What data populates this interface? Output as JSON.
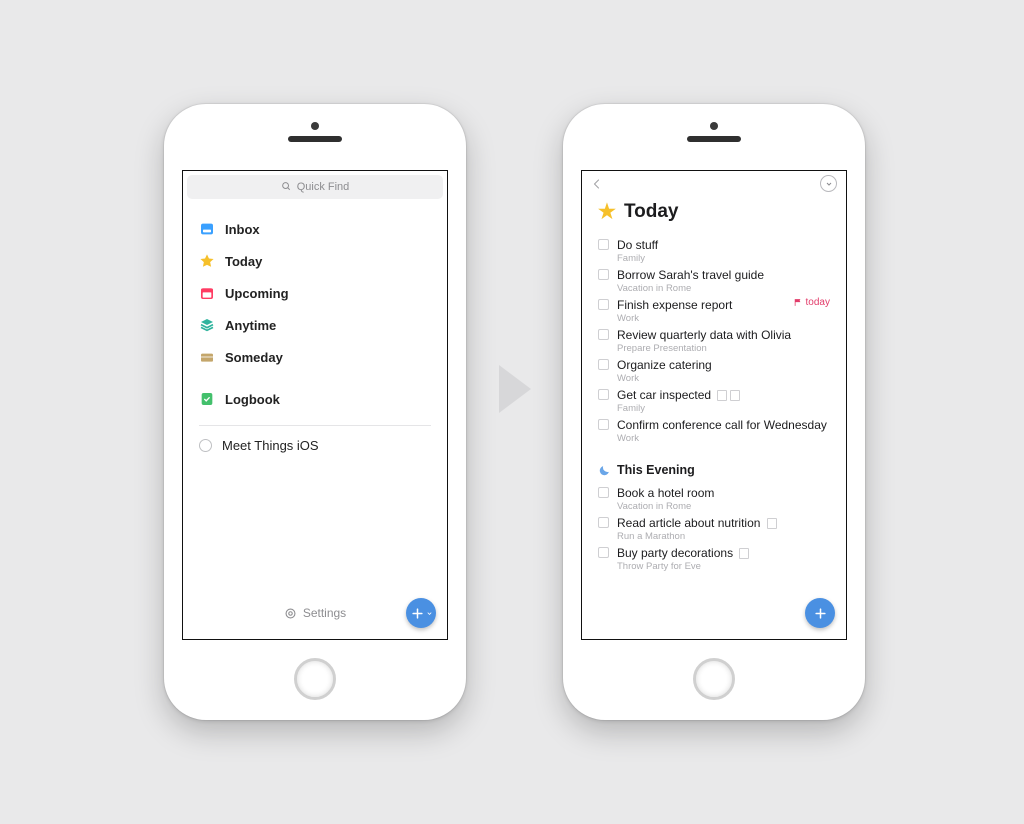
{
  "left": {
    "quickFindPlaceholder": "Quick Find",
    "nav": [
      {
        "label": "Inbox"
      },
      {
        "label": "Today"
      },
      {
        "label": "Upcoming"
      },
      {
        "label": "Anytime"
      },
      {
        "label": "Someday"
      },
      {
        "label": "Logbook"
      }
    ],
    "project": {
      "label": "Meet Things iOS"
    },
    "settingsLabel": "Settings"
  },
  "right": {
    "title": "Today",
    "tasks": [
      {
        "title": "Do stuff",
        "sub": "Family"
      },
      {
        "title": "Borrow Sarah's travel guide",
        "sub": "Vacation in Rome"
      },
      {
        "title": "Finish expense report",
        "sub": "Work",
        "flag": "today"
      },
      {
        "title": "Review quarterly data with Olivia",
        "sub": "Prepare Presentation"
      },
      {
        "title": "Organize catering",
        "sub": "Work"
      },
      {
        "title": "Get car inspected",
        "sub": "Family",
        "badges": true
      },
      {
        "title": "Confirm conference call for Wednesday",
        "sub": "Work"
      }
    ],
    "eveningTitle": "This Evening",
    "evening": [
      {
        "title": "Book a hotel room",
        "sub": "Vacation in Rome"
      },
      {
        "title": "Read article about nutrition",
        "sub": "Run a Marathon",
        "badges1": true
      },
      {
        "title": "Buy party decorations",
        "sub": "Throw Party for Eve",
        "badges1": true
      }
    ]
  }
}
